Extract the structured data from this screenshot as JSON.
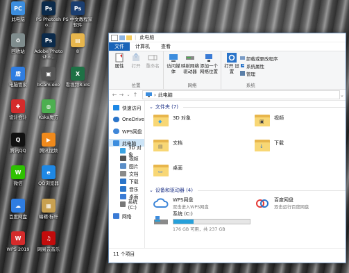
{
  "desktop": {
    "icons": [
      {
        "label": "此电脑",
        "color": "#3c8dde",
        "glyph": "PC"
      },
      {
        "label": "PS Photosho...",
        "color": "#0b2a4a",
        "glyph": "Ps"
      },
      {
        "label": "PS 中文教程家 软件",
        "color": "#1b3e70",
        "glyph": "Ps"
      },
      {
        "label": "回收站",
        "color": "#7f8c8d",
        "glyph": "♻"
      },
      {
        "label": "Adobe Photosho...",
        "color": "#0b2a4a",
        "glyph": "Ps"
      },
      {
        "label": "8",
        "color": "#e8b64c",
        "glyph": "▤"
      },
      {
        "label": "电脑管家",
        "color": "#2f7de1",
        "glyph": "盾"
      },
      {
        "label": "bCam.exe",
        "color": "#555555",
        "glyph": "▣"
      },
      {
        "label": "看视频8.xls",
        "color": "#1e7145",
        "glyph": "X"
      },
      {
        "label": "设计会计",
        "color": "#d42b2b",
        "glyph": "✚"
      },
      {
        "label": "Koka魔方",
        "color": "#4caf50",
        "glyph": "◍"
      },
      {
        "label": "腾讯QQ",
        "color": "#111111",
        "glyph": "Q"
      },
      {
        "label": "腾讯视频",
        "color": "#f08a1c",
        "glyph": "▶"
      },
      {
        "label": "微信",
        "color": "#2dc100",
        "glyph": "W"
      },
      {
        "label": "QQ浏览器",
        "color": "#1e88e5",
        "glyph": "e"
      },
      {
        "label": "百度网盘",
        "color": "#2f7de1",
        "glyph": "☁"
      },
      {
        "label": "编辑·标杆",
        "color": "#c8a050",
        "glyph": "▦"
      },
      {
        "label": "WPS 2019",
        "color": "#d42b2b",
        "glyph": "W"
      },
      {
        "label": "网易云音乐",
        "color": "#c20c0c",
        "glyph": "♫"
      }
    ]
  },
  "window": {
    "title": "此电脑",
    "menu": [
      "文件",
      "计算机",
      "查看"
    ],
    "ribbon": {
      "location_group": "位置",
      "location_buttons": [
        "属性",
        "打开",
        "重命名"
      ],
      "network_group": "网络",
      "network_buttons": [
        "访问媒体",
        "映射网络 驱动器",
        "添加一个 网络位置"
      ],
      "system_group": "系统",
      "open_settings": "打开 设置",
      "system_items": [
        "卸载或更改程序",
        "系统属性",
        "管理"
      ]
    },
    "address": {
      "path": "此电脑"
    },
    "navpane": [
      {
        "label": "快速访问",
        "indent": false,
        "icon": "star-icon",
        "color": "#1e88e5"
      },
      {
        "label": "OneDrive",
        "indent": false,
        "icon": "cloud-icon",
        "color": "#2a74c9"
      },
      {
        "label": "WPS网盘",
        "indent": false,
        "icon": "cloud-icon",
        "color": "#3e86d8"
      },
      {
        "label": "此电脑",
        "indent": false,
        "icon": "computer-icon",
        "color": "#3c8dde",
        "selected": true
      },
      {
        "label": "3D 对象",
        "indent": true,
        "icon": "cube-icon",
        "color": "#3aa3e3"
      },
      {
        "label": "视频",
        "indent": true,
        "icon": "video-icon",
        "color": "#555555"
      },
      {
        "label": "图片",
        "indent": true,
        "icon": "picture-icon",
        "color": "#5b8ec7"
      },
      {
        "label": "文档",
        "indent": true,
        "icon": "document-icon",
        "color": "#8a8a8a"
      },
      {
        "label": "下载",
        "indent": true,
        "icon": "download-icon",
        "color": "#2a74c9"
      },
      {
        "label": "音乐",
        "indent": true,
        "icon": "music-icon",
        "color": "#2a74c9"
      },
      {
        "label": "桌面",
        "indent": true,
        "icon": "desktop-icon",
        "color": "#3a7bd5"
      },
      {
        "label": "系统 (C:)",
        "indent": true,
        "icon": "drive-icon",
        "color": "#777777"
      },
      {
        "label": "网络",
        "indent": false,
        "icon": "network-icon",
        "color": "#3a7bd5"
      }
    ],
    "folders_header": "文件夹 (7)",
    "folders": [
      {
        "label": "3D 对象",
        "emblem": "◆",
        "emblem_color": "#3aa3e3"
      },
      {
        "label": "视频",
        "emblem": "▣",
        "emblem_color": "#444444"
      },
      {
        "label": "文档",
        "emblem": "▤",
        "emblem_color": "#6a6a6a"
      },
      {
        "label": "下载",
        "emblem": "↓",
        "emblem_color": "#2a74c9"
      },
      {
        "label": "桌面",
        "emblem": "▭",
        "emblem_color": "#3a7bd5"
      }
    ],
    "devices_header": "设备和驱动器 (4)",
    "devices": [
      {
        "name": "WPS网盘",
        "sub": "双击进入WPS网盘",
        "color": "#3e86d8"
      },
      {
        "name": "百度网盘",
        "sub": "双击运行百度网盘",
        "color": "#e53935"
      }
    ],
    "drive": {
      "name": "系统 (C:)",
      "free_text": "176 GB 可用，共 237 GB",
      "used_fraction": 0.26
    },
    "status": "11 个项目"
  }
}
